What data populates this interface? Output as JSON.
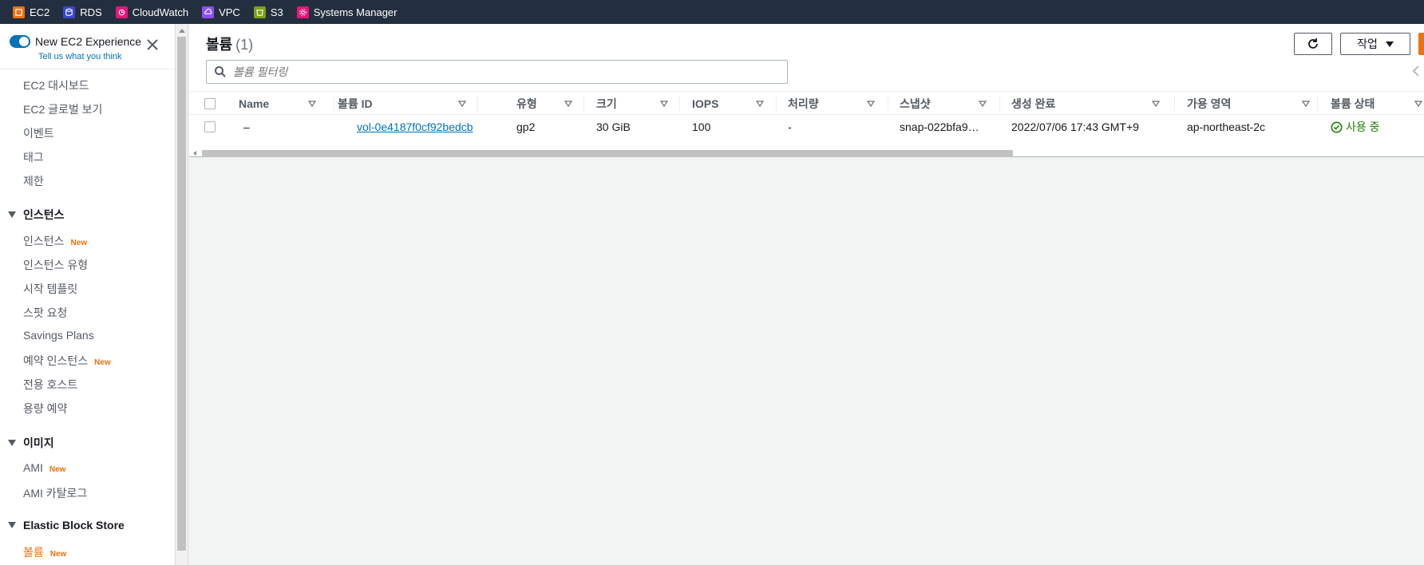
{
  "favorites": [
    {
      "label": "EC2",
      "icon": "ec2-icon",
      "color": "#ec7211"
    },
    {
      "label": "RDS",
      "icon": "rds-icon",
      "color": "#3b48cc"
    },
    {
      "label": "CloudWatch",
      "icon": "cloudwatch-icon",
      "color": "#e7157b"
    },
    {
      "label": "VPC",
      "icon": "vpc-icon",
      "color": "#8c4fff"
    },
    {
      "label": "S3",
      "icon": "s3-icon",
      "color": "#7aa116"
    },
    {
      "label": "Systems Manager",
      "icon": "systems-manager-icon",
      "color": "#e7157b"
    }
  ],
  "sidebar": {
    "experience_title": "New EC2 Experience",
    "experience_subtitle": "Tell us what you think",
    "new_badge": "New",
    "top_items": [
      "EC2 대시보드",
      "EC2 글로벌 보기",
      "이벤트",
      "태그",
      "제한"
    ],
    "sections": {
      "instances": {
        "title": "인스턴스",
        "items": [
          "인스턴스",
          "인스턴스 유형",
          "시작 템플릿",
          "스팟 요청",
          "Savings Plans",
          "예약 인스턴스",
          "전용 호스트",
          "용량 예약"
        ]
      },
      "images": {
        "title": "이미지",
        "items": [
          "AMI",
          "AMI 카탈로그"
        ]
      },
      "ebs": {
        "title": "Elastic Block Store",
        "items": [
          "볼륨"
        ]
      }
    }
  },
  "main": {
    "title": "볼륨",
    "count": "(1)",
    "actions_label": "작업",
    "search_placeholder": "볼륨 필터링",
    "columns": [
      "Name",
      "볼륨 ID",
      "유형",
      "크기",
      "IOPS",
      "처리량",
      "스냅샷",
      "생성 완료",
      "가용 영역",
      "볼륨 상태"
    ],
    "rows": [
      {
        "name": "–",
        "volume_id": "vol-0e4187f0cf92bedcb",
        "type": "gp2",
        "size": "30 GiB",
        "iops": "100",
        "throughput": "-",
        "snapshot": "snap-022bfa9…",
        "created": "2022/07/06 17:43 GMT+9",
        "az": "ap-northeast-2c",
        "status": "사용 중"
      }
    ]
  },
  "colors": {
    "accent_orange": "#ec7211",
    "link_blue": "#0073bb",
    "status_green": "#1d8102",
    "topbar": "#232f3e"
  }
}
